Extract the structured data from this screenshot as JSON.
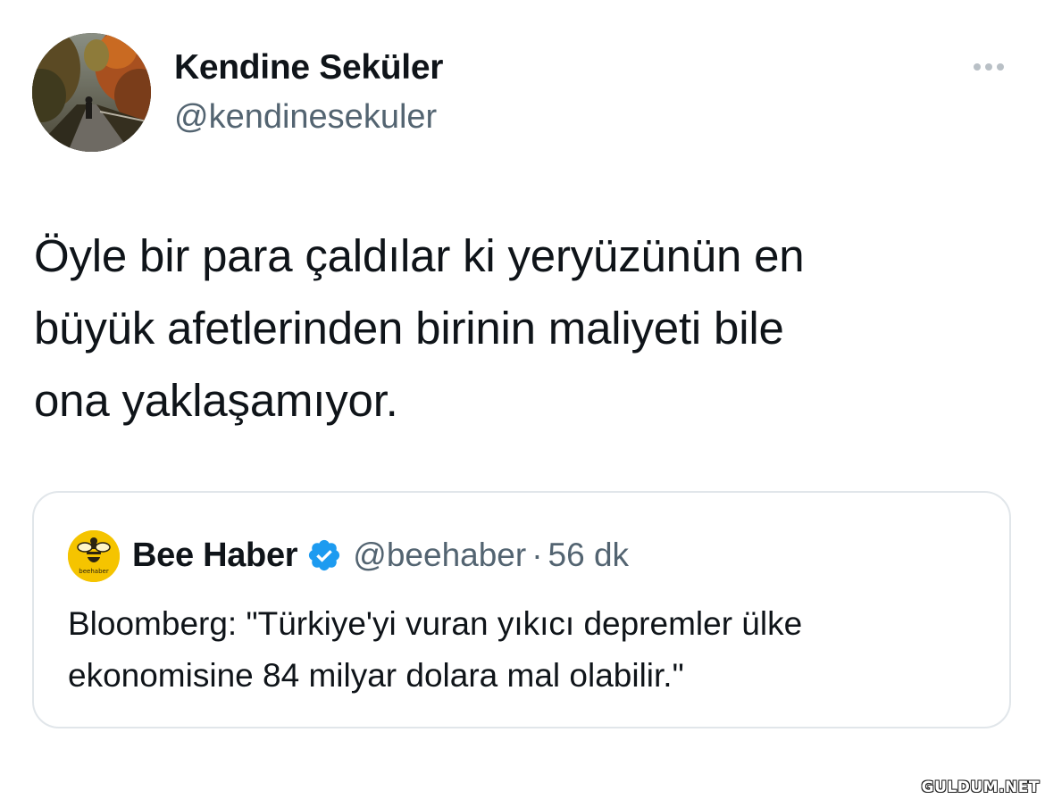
{
  "author": {
    "display_name": "Kendine Seküler",
    "handle": "@kendinesekuler"
  },
  "menu": {
    "icon": "more-horizontal-icon"
  },
  "tweet": {
    "text": "Öyle bir para çaldılar ki yeryüzünün en\nbüyük afetlerinden birinin maliyeti bile\nona yaklaşamıyor."
  },
  "quoted_tweet": {
    "display_name": "Bee Haber",
    "verified_icon": "verified-badge-icon",
    "handle": "@beehaber",
    "separator": "·",
    "time": "56 dk",
    "text": "Bloomberg: \"Türkiye'yi vuran yıkıcı depremler ülke\nekonomisine 84 milyar dolara mal olabilir.\"",
    "avatar_label": "beehaber"
  },
  "watermark": {
    "text": "GULDUM.NET"
  },
  "colors": {
    "primary_text": "#0f1419",
    "secondary_text": "#536471",
    "border": "#e1e6ea",
    "verified": "#1d9bf0",
    "bee_yellow": "#f5c400"
  }
}
